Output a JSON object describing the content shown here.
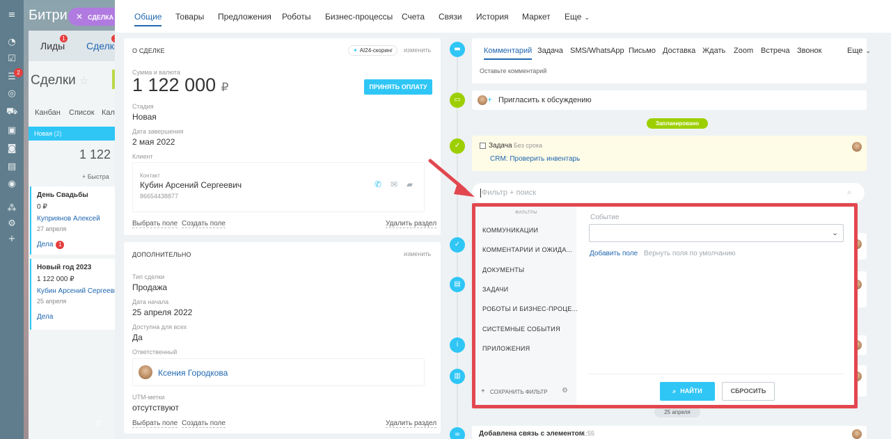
{
  "rail": {
    "badge_top": "2"
  },
  "bg_crm": {
    "brand": "Битри",
    "tabs": [
      {
        "label": "Лиды",
        "badge": "1"
      },
      {
        "label": "Сделки",
        "badge": "1"
      }
    ],
    "title": "Сделки",
    "views": [
      "Канбан",
      "Список",
      "Кал"
    ],
    "stage": {
      "name": "Новая",
      "count": "(2)",
      "sum": "1 122"
    },
    "quick_add": "+ Быстра",
    "cards": [
      {
        "title": "День Свадьбы",
        "sum": "0 ₽",
        "client": "Куприянов Алексей",
        "date": "27 апреля",
        "link": "Дела",
        "badge": "1"
      },
      {
        "title": "Новый год 2023",
        "sum": "1 122 000 ₽",
        "client": "Кубин Арсений Сергеевич",
        "date": "25 апреля",
        "link": "Дела",
        "badge": ""
      }
    ]
  },
  "deal_pill": "СДЕЛКА",
  "topnav": [
    {
      "label": "Общие",
      "active": true
    },
    {
      "label": "Товары"
    },
    {
      "label": "Предложения"
    },
    {
      "label": "Роботы"
    },
    {
      "label": "Бизнес-процессы"
    },
    {
      "label": "Счета"
    },
    {
      "label": "Связи"
    },
    {
      "label": "История"
    },
    {
      "label": "Маркет"
    },
    {
      "label": "Еще"
    }
  ],
  "about": {
    "title": "О СДЕЛКЕ",
    "ai_badge": "AI24-скоринг",
    "edit": "изменить",
    "sum_label": "Сумма и валюта",
    "sum_value": "1 122 000",
    "currency": "₽",
    "pay_button": "ПРИНЯТЬ ОПЛАТУ",
    "stage_label": "Стадия",
    "stage_value": "Новая",
    "close_label": "Дата завершения",
    "close_value": "2 мая 2022",
    "client_label": "Клиент",
    "contact_label": "Контакт",
    "contact_name": "Кубин Арсений Сергеевич",
    "contact_phone": "86654438877",
    "select_field": "Выбрать поле",
    "create_field": "Создать поле",
    "delete_section": "Удалить раздел"
  },
  "extra": {
    "title": "ДОПОЛНИТЕЛЬНО",
    "edit": "изменить",
    "type_label": "Тип сделки",
    "type_value": "Продажа",
    "start_label": "Дата начала",
    "start_value": "25 апреля 2022",
    "access_label": "Доступна для всех",
    "access_value": "Да",
    "resp_label": "Ответственный",
    "resp_name": "Ксения Городкова",
    "utm_label": "UTM-метки",
    "utm_value": "отсутствуют",
    "select_field": "Выбрать поле",
    "create_field": "Создать поле",
    "delete_section": "Удалить раздел"
  },
  "timeline": {
    "tabs": [
      {
        "label": "Комментарий",
        "active": true
      },
      {
        "label": "Задача"
      },
      {
        "label": "SMS/WhatsApp"
      },
      {
        "label": "Письмо"
      },
      {
        "label": "Доставка"
      },
      {
        "label": "Ждать"
      },
      {
        "label": "Zoom"
      },
      {
        "label": "Встреча"
      },
      {
        "label": "Звонок"
      }
    ],
    "more": "Еще",
    "comment_placeholder": "Оставьте комментарий",
    "invite": "Пригласить к обсуждению",
    "planned": "Запланировано",
    "task_title": "Задача",
    "task_deadline": "Без срока",
    "task_desc": "CRM: Проверить инвентарь",
    "date_pill": "25 апреля",
    "last_item": "Добавлена связь с элементом",
    "last_time": "11:55"
  },
  "filter": {
    "search_placeholder": "Фильтр + поиск",
    "filters_header": "ФИЛЬТРЫ",
    "items": [
      "КОММУНИКАЦИИ",
      "КОММЕНТАРИИ И ОЖИДА...",
      "ДОКУМЕНТЫ",
      "ЗАДАЧИ",
      "РОБОТЫ И БИЗНЕС-ПРОЦЕ...",
      "СИСТЕМНЫЕ СОБЫТИЯ",
      "ПРИЛОЖЕНИЯ"
    ],
    "save_filter": "СОХРАНИТЬ ФИЛЬТР",
    "event_label": "Событие",
    "add_field": "Добавить поле",
    "restore_fields": "Вернуть поля по умолчанию",
    "find": "НАЙТИ",
    "reset": "СБРОСИТЬ"
  },
  "colors": {
    "accent": "#2fc6f6",
    "link": "#2067b0",
    "annotation": "#e2474f",
    "planned": "#9dcf00"
  }
}
